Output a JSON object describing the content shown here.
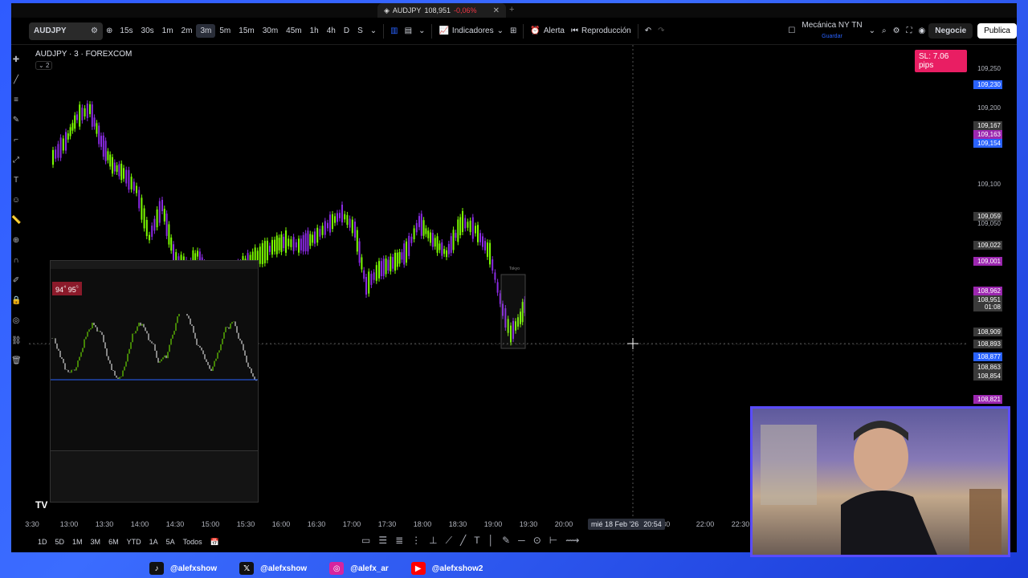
{
  "browser_tab": {
    "symbol": "AUDJPY",
    "price": "108,951",
    "change": "-0,06%"
  },
  "toolbar": {
    "symbol": "AUDJPY",
    "timeframes": [
      "15s",
      "30s",
      "1m",
      "2m",
      "3m",
      "5m",
      "15m",
      "30m",
      "45m",
      "1h",
      "4h",
      "D",
      "S"
    ],
    "active_timeframe": "3m",
    "indicators_label": "Indicadores",
    "alert_label": "Alerta",
    "replay_label": "Reproducción",
    "layout_name": "Mecánica NY TN",
    "layout_sub": "Guardar",
    "trade_label": "Negocie",
    "publish_label": "Publica"
  },
  "chart": {
    "title": "AUDJPY · 3 · FOREXCOM",
    "collapse_count": "2",
    "sl_badge": "SL: 7.06 pips",
    "broker_price_1": "94",
    "broker_price_2": "95",
    "broker_candle_label": "Tokyo"
  },
  "price_scale": [
    {
      "value": "109,250",
      "type": "plain"
    },
    {
      "value": "109,230",
      "type": "blue"
    },
    {
      "value": "109,200",
      "type": "plain"
    },
    {
      "value": "109,167",
      "type": "gray"
    },
    {
      "value": "109,163",
      "type": "purple"
    },
    {
      "value": "109,154",
      "type": "blue"
    },
    {
      "value": "109,100",
      "type": "plain"
    },
    {
      "value": "109,059",
      "type": "gray"
    },
    {
      "value": "109,050",
      "type": "plain"
    },
    {
      "value": "109,022",
      "type": "gray"
    },
    {
      "value": "109,001",
      "type": "purple"
    },
    {
      "value": "108,962",
      "type": "purple"
    },
    {
      "value": "108,951",
      "type": "gray"
    },
    {
      "value": "01:08",
      "type": "gray"
    },
    {
      "value": "108,909",
      "type": "gray"
    },
    {
      "value": "108,893",
      "type": "gray"
    },
    {
      "value": "108,877",
      "type": "blue"
    },
    {
      "value": "108,863",
      "type": "gray"
    },
    {
      "value": "108,854",
      "type": "gray"
    },
    {
      "value": "108,821",
      "type": "purple"
    }
  ],
  "time_axis": {
    "labels": [
      "3:30",
      "13:00",
      "13:30",
      "14:00",
      "14:30",
      "15:00",
      "15:30",
      "16:00",
      "16:30",
      "17:00",
      "17:30",
      "18:00",
      "18:30",
      "19:00",
      "19:30",
      "20:00",
      ":30",
      "22:00",
      "22:30"
    ],
    "cursor_date": "mié 18 Feb '26",
    "cursor_time": "20:54"
  },
  "bottom_bar": {
    "ranges": [
      "1D",
      "5D",
      "1M",
      "3M",
      "6M",
      "YTD",
      "1A",
      "5A",
      "Todos"
    ]
  },
  "social": [
    {
      "icon": "tiktok-icon",
      "handle": "@alefxshow",
      "color": "#111111"
    },
    {
      "icon": "x-icon",
      "handle": "@alefxshow",
      "color": "#111111"
    },
    {
      "icon": "instagram-icon",
      "handle": "@alefx_ar",
      "color": "#d6249f"
    },
    {
      "icon": "youtube-icon",
      "handle": "@alefxshow2",
      "color": "#ff0000"
    }
  ],
  "colors": {
    "bull": "#7CFC00",
    "bear": "#8a2be2",
    "accent": "#2962ff",
    "sl": "#e91e63"
  }
}
